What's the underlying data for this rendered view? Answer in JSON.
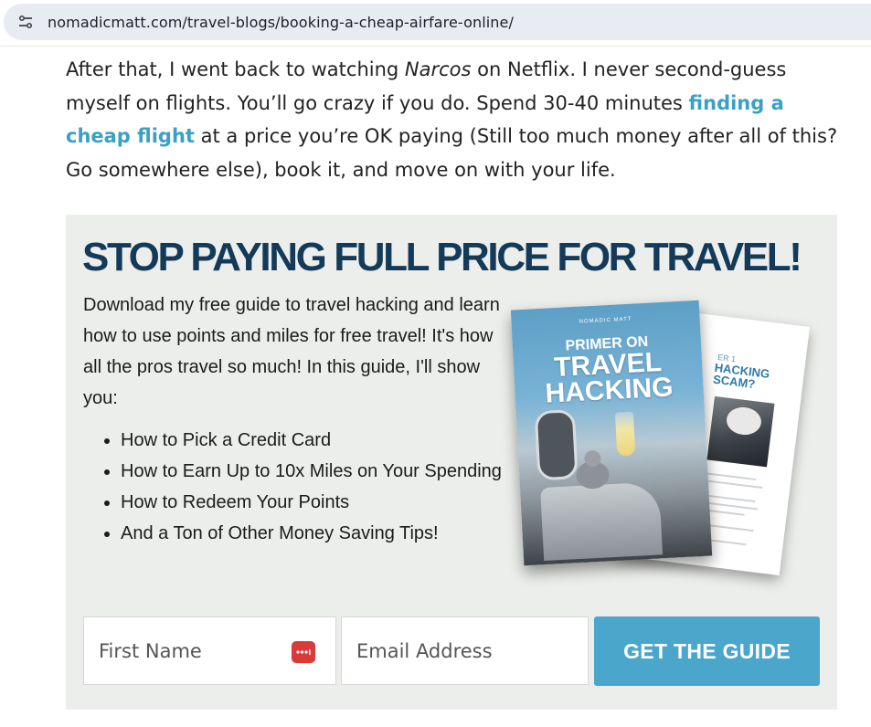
{
  "browser": {
    "url": "nomadicmatt.com/travel-blogs/booking-a-cheap-airfare-online/",
    "site_info_icon": "tune-icon"
  },
  "article": {
    "text_1": "After that, I went back to watching ",
    "italic": "Narcos",
    "text_2": " on Netflix. I never second-guess myself on flights. You’ll go crazy if you do. Spend 30-40 minutes ",
    "link": "finding a cheap flight",
    "text_3": " at a price you’re OK paying (Still too much money after all of this? Go somewhere else), book it, and move on with your life.",
    "link_color": "#3aa0c5"
  },
  "guide": {
    "title": "STOP PAYING FULL PRICE FOR TRAVEL!",
    "intro": "Download my free guide to travel hacking and learn how to use points and miles for free travel! It's how all the pros travel so much! In this guide, I'll show you:",
    "bullets": [
      "How to Pick a Credit Card",
      "How to Earn Up to 10x Miles on Your Spending",
      "How to Redeem Your Points",
      "And a Ton of Other Money Saving Tips!"
    ],
    "book": {
      "brand": "NOMADIC MATT",
      "title_line1": "PRIMER ON",
      "title_line2": "TRAVEL HACKING",
      "back_chapter": "ER 1",
      "back_title": "HACKING SCAM?"
    },
    "form": {
      "first_name_placeholder": "First Name",
      "email_placeholder": "Email Address",
      "submit_label": "GET THE GUIDE",
      "password_manager_icon": "password-manager-icon"
    },
    "colors": {
      "box_background": "#eceeeb",
      "title": "#143a5a",
      "button": "#4aa6cb"
    }
  }
}
